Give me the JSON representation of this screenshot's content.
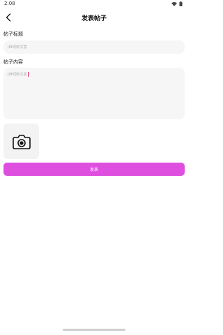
{
  "status_bar": {
    "time": "2:08",
    "icons": [
      "wifi-icon",
      "battery-icon"
    ]
  },
  "nav": {
    "back_icon": "back-arrow-icon",
    "title": "发表帖子"
  },
  "form": {
    "title_label": "帖子标题",
    "title_placeholder": "J8P词你文意",
    "content_label": "帖子内容",
    "content_placeholder": "J8P词你文意",
    "photo_icon": "camera-icon",
    "submit_label": "发表"
  },
  "colors": {
    "accent": "#de4fe0",
    "input_bg": "#f6f6f6",
    "caret": "#e0245e"
  }
}
